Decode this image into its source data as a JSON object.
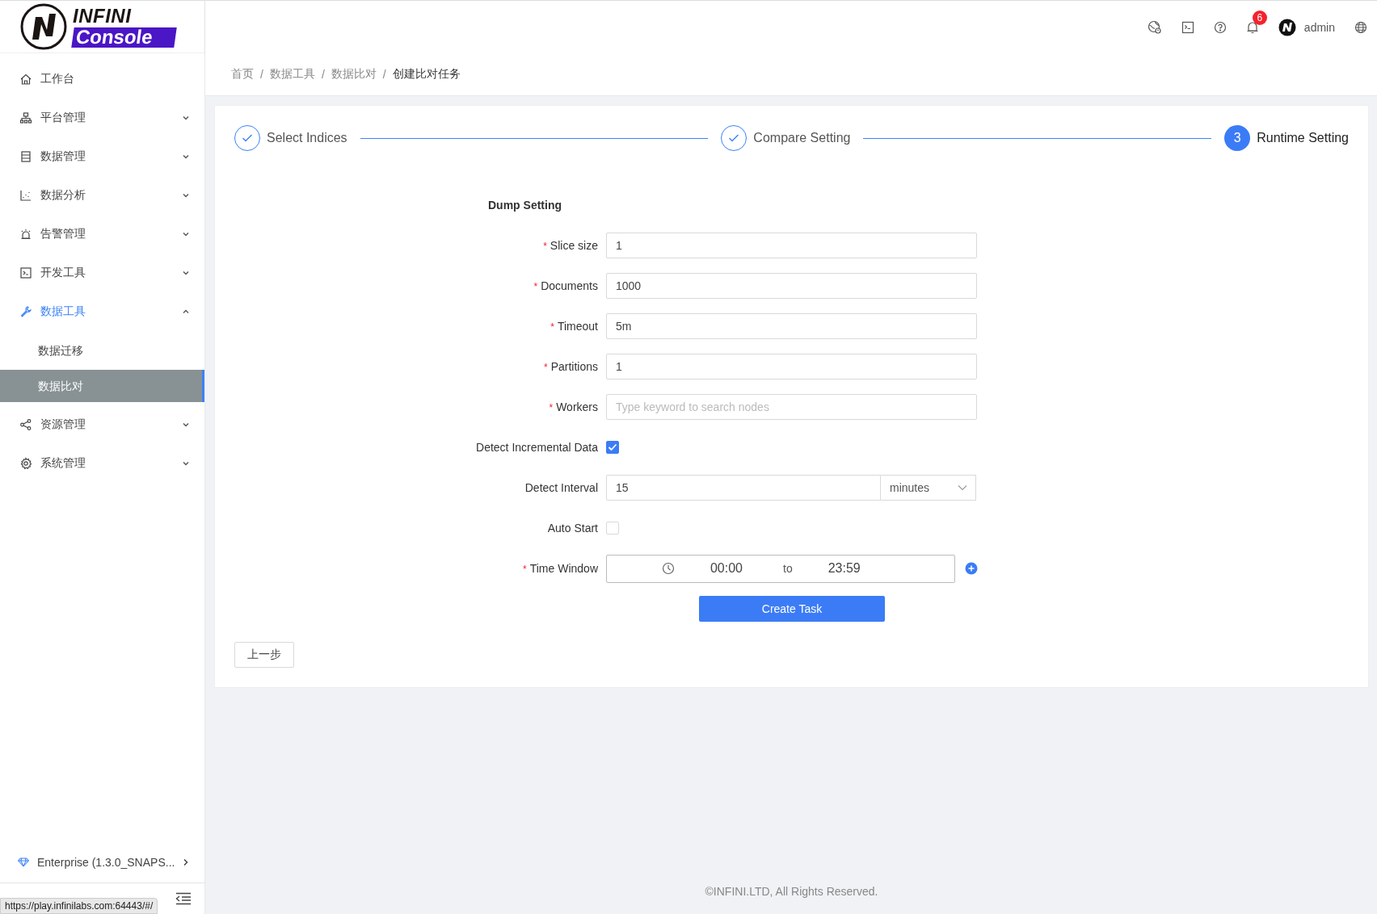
{
  "logo": {
    "line1": "INFINI",
    "line2": "Console"
  },
  "sidebar": {
    "items": [
      {
        "label": "工作台",
        "kind": "home",
        "selected": false
      },
      {
        "label": "平台管理",
        "kind": "cluster",
        "selected": false,
        "expanded": false
      },
      {
        "label": "数据管理",
        "kind": "database",
        "selected": false,
        "expanded": false
      },
      {
        "label": "数据分析",
        "kind": "chart",
        "selected": false,
        "expanded": false
      },
      {
        "label": "告警管理",
        "kind": "alert",
        "selected": false,
        "expanded": false
      },
      {
        "label": "开发工具",
        "kind": "terminal",
        "selected": false,
        "expanded": false
      },
      {
        "label": "数据工具",
        "kind": "wrench",
        "selected": true,
        "expanded": true,
        "children": [
          {
            "label": "数据迁移",
            "selected": false
          },
          {
            "label": "数据比对",
            "selected": true
          }
        ]
      },
      {
        "label": "资源管理",
        "kind": "share",
        "selected": false,
        "expanded": false
      },
      {
        "label": "系统管理",
        "kind": "gear",
        "selected": false,
        "expanded": false
      }
    ],
    "edition": "Enterprise (1.3.0_SNAPS...",
    "status_url": "https://play.infinilabs.com:64443/#/"
  },
  "header": {
    "notification_count": "6",
    "user": "admin"
  },
  "breadcrumb": {
    "separator": "/",
    "items": [
      "首页",
      "数据工具",
      "数据比对",
      "创建比对任务"
    ]
  },
  "steps": [
    {
      "label": "Select Indices",
      "kind": "done"
    },
    {
      "label": "Compare Setting",
      "kind": "done"
    },
    {
      "label": "Runtime Setting",
      "kind": "current",
      "number": "3"
    }
  ],
  "form": {
    "section_title": "Dump Setting",
    "required_mark": "*",
    "fields": [
      {
        "kind": "input",
        "label": "Slice size",
        "required": true,
        "value": "1"
      },
      {
        "kind": "input",
        "label": "Documents",
        "required": true,
        "value": "1000"
      },
      {
        "kind": "input",
        "label": "Timeout",
        "required": true,
        "value": "5m"
      },
      {
        "kind": "input",
        "label": "Partitions",
        "required": true,
        "value": "1"
      },
      {
        "kind": "input",
        "label": "Workers",
        "required": true,
        "placeholder": "Type keyword to search nodes"
      },
      {
        "kind": "checkbox",
        "label": "Detect Incremental Data",
        "required": false,
        "checked": true
      },
      {
        "kind": "interval",
        "label": "Detect Interval",
        "required": false,
        "value": "15",
        "unit": "minutes"
      },
      {
        "kind": "checkbox",
        "label": "Auto Start",
        "required": false,
        "checked": false
      },
      {
        "kind": "time_range",
        "label": "Time Window",
        "required": true,
        "start": "00:00",
        "separator": "to",
        "end": "23:59"
      }
    ],
    "submit": "Create Task"
  },
  "back_button": "上一步",
  "footer": "©INFINI.LTD, All Rights Reserved."
}
